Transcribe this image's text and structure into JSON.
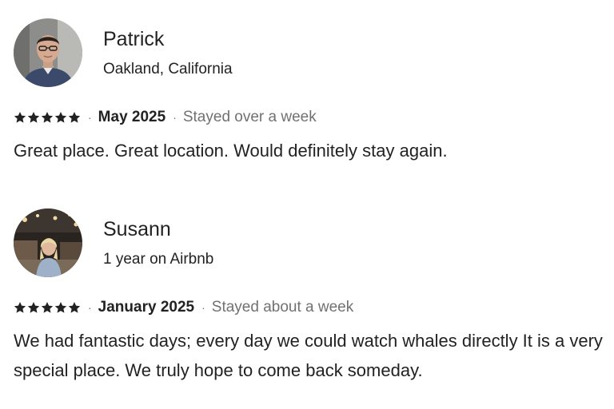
{
  "reviews": [
    {
      "name": "Patrick",
      "subline": "Oakland, California",
      "rating": 5,
      "date": "May 2025",
      "stay": "Stayed over a week",
      "text": "Great place.  Great location.  Would definitely stay again."
    },
    {
      "name": "Susann",
      "subline": "1 year on Airbnb",
      "rating": 5,
      "date": "January 2025",
      "stay": "Stayed about a week",
      "text": "We had fantastic days; every day we could watch whales directly It is a very special place. We truly hope to come back someday."
    }
  ],
  "separator": "·",
  "colors": {
    "primary_text": "#222222",
    "secondary_text": "#717171",
    "star": "#222222"
  },
  "icons": {
    "rating_star": "star-icon"
  }
}
